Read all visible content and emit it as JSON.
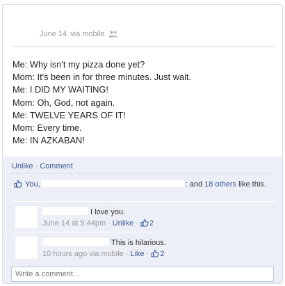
{
  "post": {
    "timestamp": "June 14",
    "via": "via mobile",
    "privacy_icon": "friends-icon",
    "lines": [
      "Me: Why isn't my pizza done yet?",
      "Mom: It's been in for three minutes. Just wait.",
      "Me: I DID MY WAITING!",
      "Mom: Oh, God, not again.",
      "Me: TWELVE YEARS OF IT!",
      "Mom: Every time.",
      "Me: IN AZKABAN!"
    ]
  },
  "actions": {
    "unlike": "Unlike",
    "comment": "Comment"
  },
  "likes": {
    "you": "You,",
    "and": ": and",
    "others": "18 others",
    "suffix": "like this.",
    "icon": "thumbs-up-icon"
  },
  "comments": [
    {
      "text": "I love you.",
      "time": "June 14 at 5:44pm",
      "unlike": "Unlike",
      "likes": "2"
    },
    {
      "text": "This is hilarious.",
      "time": "10 hours ago",
      "via": "via mobile",
      "like": "Like",
      "likes": "2"
    }
  ],
  "composer": {
    "placeholder": "Write a comment..."
  },
  "colors": {
    "link": "#3b5998",
    "feedback_bg": "#eceff5",
    "muted": "#999999"
  }
}
